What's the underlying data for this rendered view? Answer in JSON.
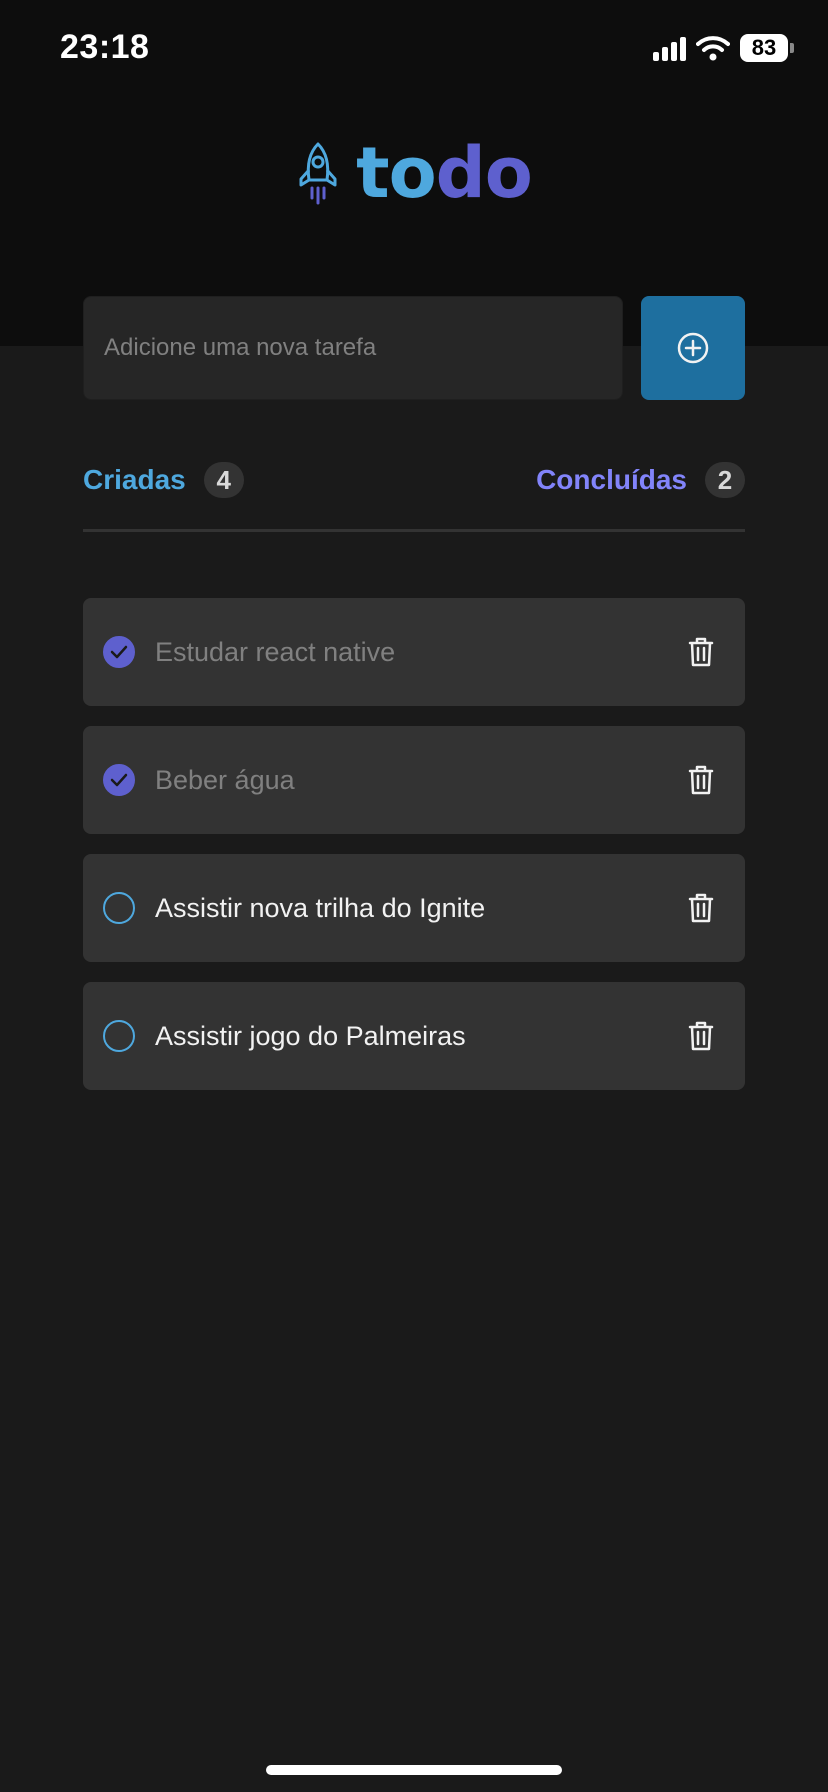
{
  "status_bar": {
    "time": "23:18",
    "battery": "83"
  },
  "logo": {
    "text_part1": "to",
    "text_part2": "do",
    "icon": "rocket-icon"
  },
  "new_task": {
    "placeholder": "Adicione uma nova tarefa",
    "value": "",
    "add_icon": "plus-circle-icon"
  },
  "counters": {
    "created_label": "Criadas",
    "created_count": "4",
    "done_label": "Concluídas",
    "done_count": "2"
  },
  "tasks": [
    {
      "title": "Estudar react native",
      "done": true
    },
    {
      "title": "Beber água",
      "done": true
    },
    {
      "title": "Assistir nova trilha do Ignite",
      "done": false
    },
    {
      "title": "Assistir jogo do Palmeiras",
      "done": false
    }
  ],
  "colors": {
    "blue": "#4ea8de",
    "purple": "#5e60ce",
    "purple_light": "#8284fa",
    "button_blue": "#1e6f9f"
  }
}
